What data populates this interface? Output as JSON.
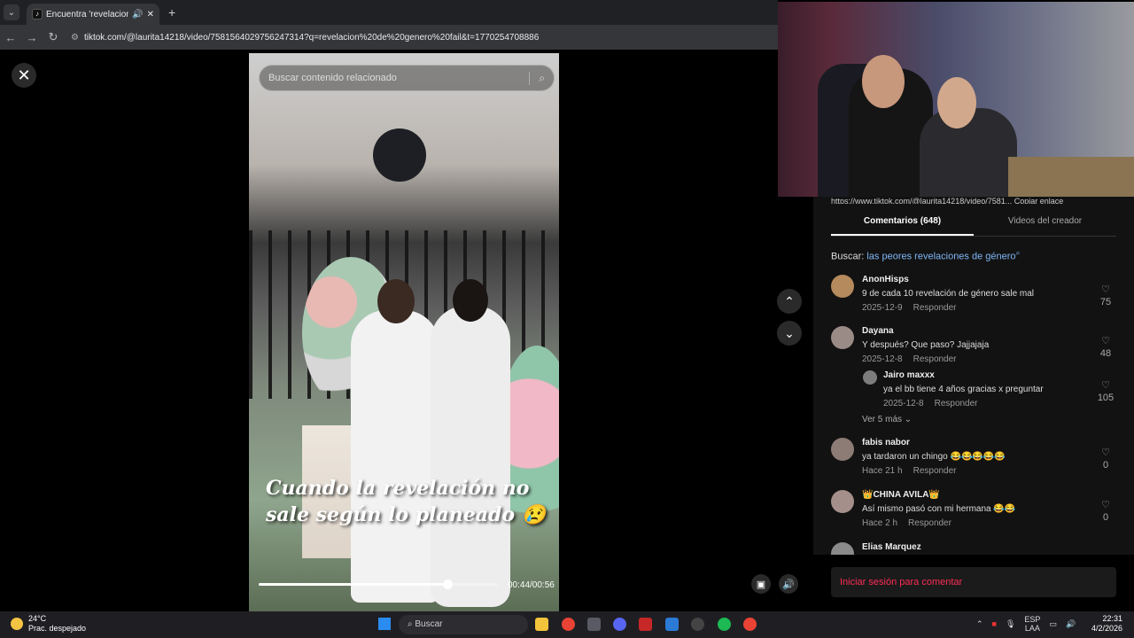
{
  "browser": {
    "tab_title": "Encuentra 'revelacion de g",
    "new_tab": "+",
    "url": "tiktok.com/@laurita14218/video/7581564029756247314?q=revelacion%20de%20genero%20fail&t=1770254708886"
  },
  "video": {
    "search_placeholder": "Buscar contenido relacionado",
    "caption": "Cuando la revelación no sale según lo planeado 😢",
    "timecode": "00:44/00:56",
    "progress": 0.79
  },
  "panel": {
    "clipped_link_text": "https://www.tiktok.com/@laurita14218/video/7581... Copiar enlace",
    "tabs": [
      {
        "label": "Comentarios (648)",
        "active": true
      },
      {
        "label": "Videos del creador",
        "active": false
      }
    ],
    "search_prefix": "Buscar:",
    "search_link": "las peores revelaciones de género",
    "comments": [
      {
        "name": "AnonHisps",
        "text": "9 de cada 10 revelación de género sale mal",
        "date": "2025-12-9",
        "reply": "Responder",
        "likes": "75"
      },
      {
        "name": "Dayana",
        "text": "Y después? Que paso? Jajjajaja",
        "date": "2025-12-8",
        "reply": "Responder",
        "likes": "48"
      },
      {
        "name": "Jairo maxxx",
        "text": "ya el bb tiene 4 años gracias x preguntar",
        "date": "2025-12-8",
        "reply": "Responder",
        "likes": "105"
      },
      {
        "name": "fabis nabor",
        "text": "ya tardaron un chingo 😂😂😂😂😂",
        "date": "Hace 21 h",
        "reply": "Responder",
        "likes": "0"
      },
      {
        "name": "👑CHINA AVILA👑",
        "text": "Así mismo pasó con mi hermana 😂😂",
        "date": "Hace 2 h",
        "reply": "Responder",
        "likes": "0"
      },
      {
        "name": "Elias Marquez"
      }
    ],
    "more_replies": "Ver 5 más ⌄",
    "login": "Iniciar sesión para comentar"
  },
  "taskbar": {
    "temp": "24°C",
    "weather": "Prac. despejado",
    "search": "Buscar",
    "lang1": "ESP",
    "lang2": "LAA",
    "time": "22:31",
    "date": "4/2/2026"
  }
}
